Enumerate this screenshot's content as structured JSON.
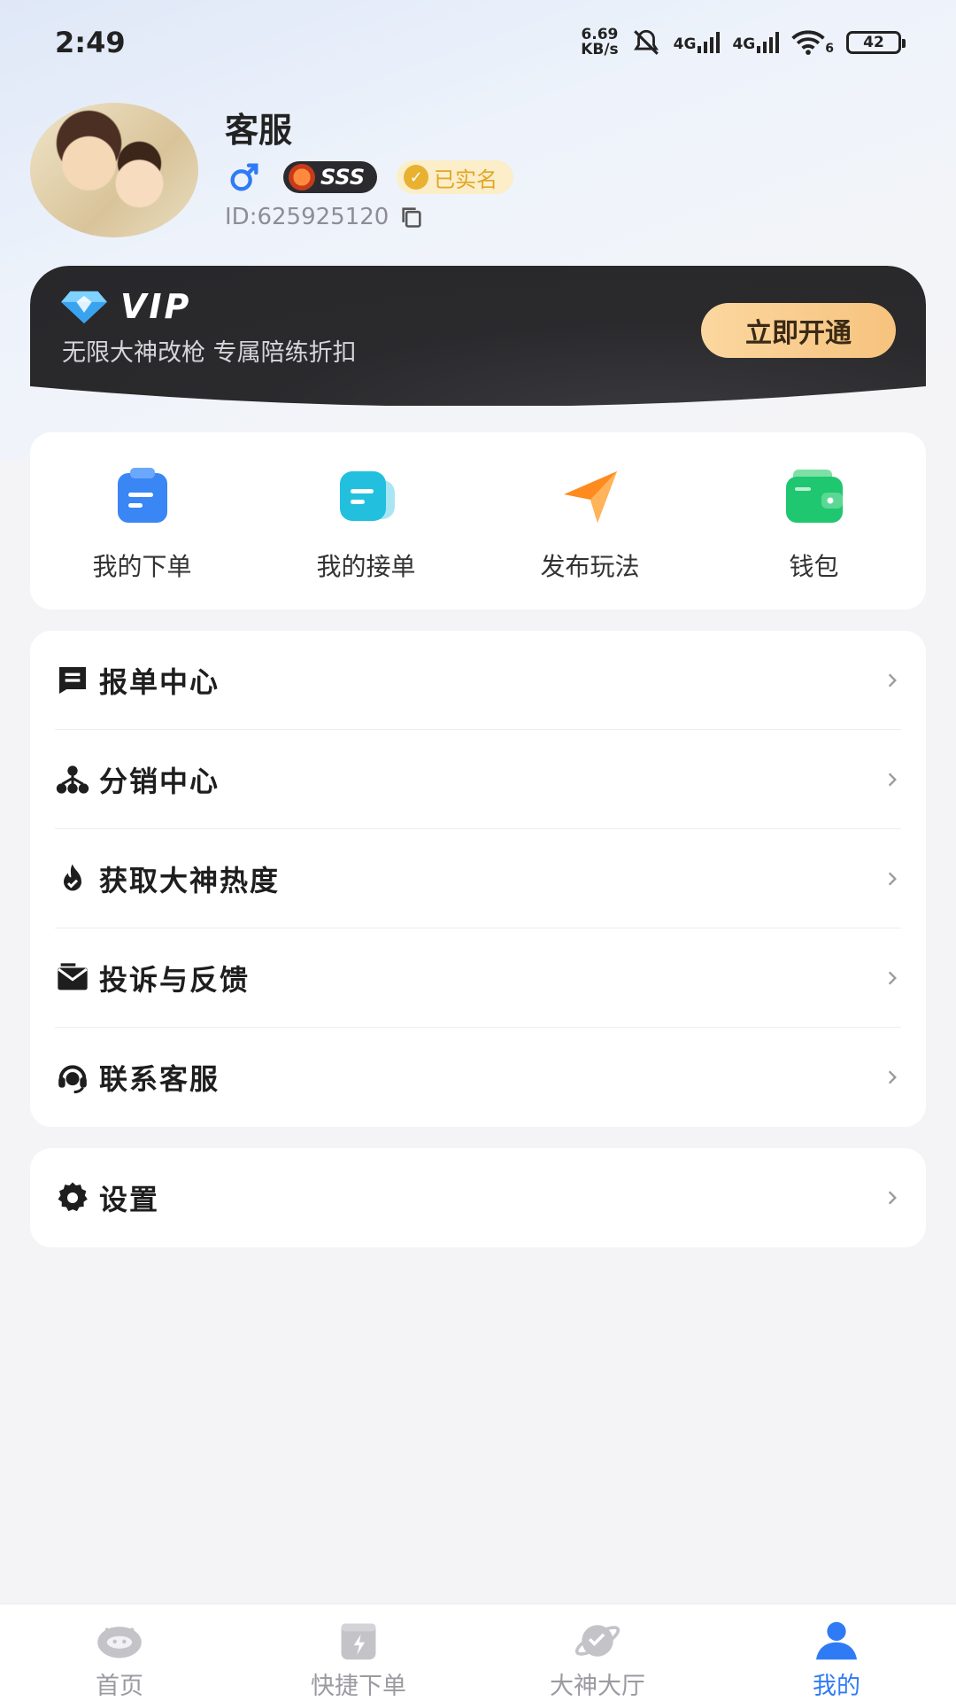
{
  "status_bar": {
    "time": "2:49",
    "net_speed_value": "6.69",
    "net_speed_unit": "KB/s",
    "sig1_label": "4G",
    "sig2_label": "4G",
    "wifi_sub": "6",
    "battery": "42"
  },
  "profile": {
    "nickname": "客服",
    "gender_symbol": "♂",
    "rank_badge": "SSS",
    "verified_badge": "已实名",
    "user_id": "ID:625925120"
  },
  "vip": {
    "title": "VIP",
    "subtitle": "无限大神改枪 专属陪练折扣",
    "button": "立即开通"
  },
  "quick_actions": [
    {
      "label": "我的下单",
      "icon": "order-clipboard-icon"
    },
    {
      "label": "我的接单",
      "icon": "accept-order-icon"
    },
    {
      "label": "发布玩法",
      "icon": "paper-plane-icon"
    },
    {
      "label": "钱包",
      "icon": "wallet-icon"
    }
  ],
  "menu": [
    {
      "label": "报单中心",
      "icon": "report-list-icon"
    },
    {
      "label": "分销中心",
      "icon": "distribution-network-icon"
    },
    {
      "label": "获取大神热度",
      "icon": "flame-icon"
    },
    {
      "label": "投诉与反馈",
      "icon": "mail-feedback-icon"
    },
    {
      "label": "联系客服",
      "icon": "headset-icon"
    }
  ],
  "settings": {
    "label": "设置",
    "icon": "gear-icon"
  },
  "tabs": [
    {
      "label": "首页",
      "icon": "home-mascot-icon",
      "active": false
    },
    {
      "label": "快捷下单",
      "icon": "quick-order-icon",
      "active": false
    },
    {
      "label": "大神大厅",
      "icon": "planet-icon",
      "active": false
    },
    {
      "label": "我的",
      "icon": "person-icon",
      "active": true
    }
  ],
  "colors": {
    "accent": "#2f7bf6",
    "vip_card": "#2a2a2d",
    "vip_button": "#f7c37e",
    "verified": "#e2a627",
    "gender": "#2f7bf6"
  }
}
